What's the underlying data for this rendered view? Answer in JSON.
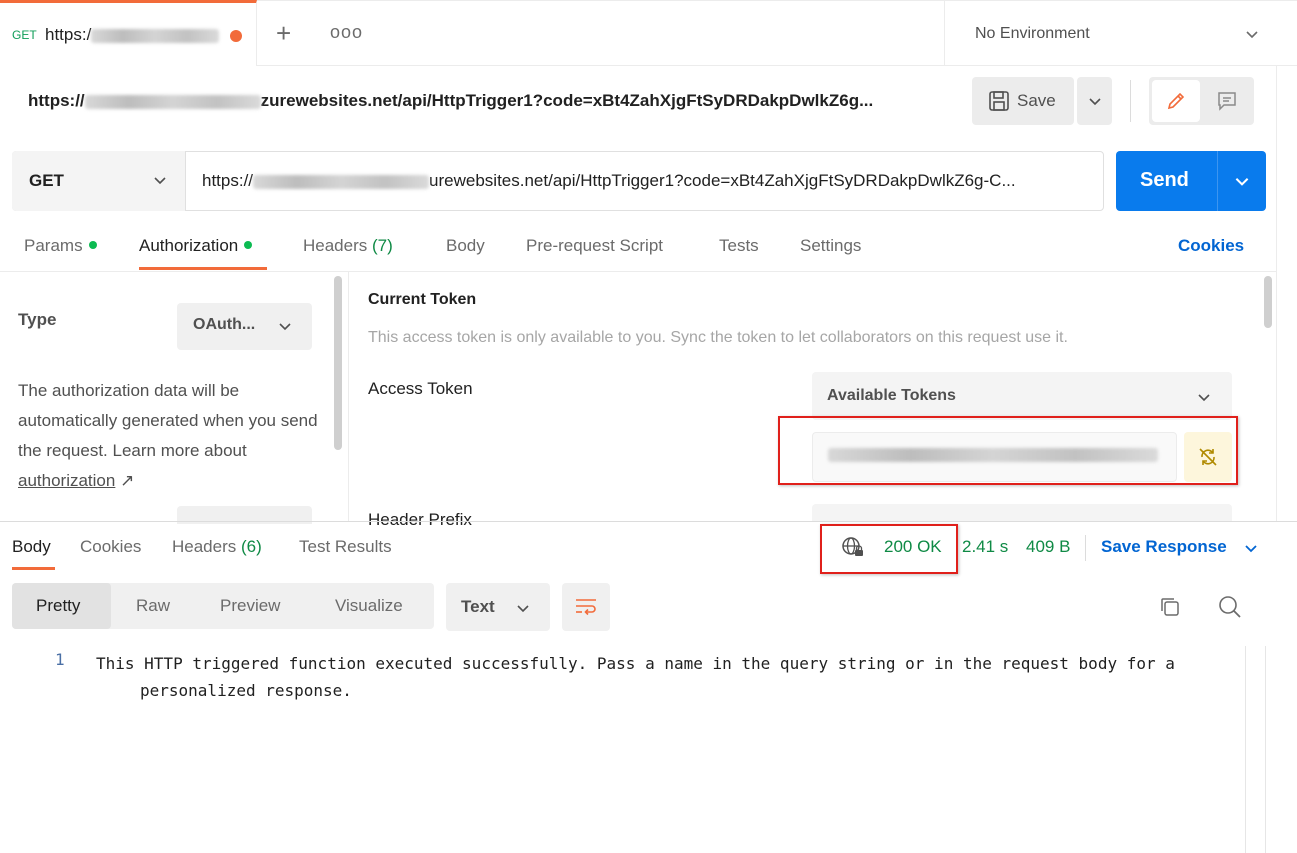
{
  "tab": {
    "method": "GET",
    "url_prefix": "https:/"
  },
  "tabbar": {
    "new_tab": "+",
    "more": "ooo"
  },
  "environment": {
    "label": "No Environment"
  },
  "request": {
    "name_prefix": "https://",
    "name_suffix": "zurewebsites.net/api/HttpTrigger1?code=xBt4ZahXjgFtSyDRDakpDwlkZ6g...",
    "save_label": "Save"
  },
  "urlbar": {
    "method": "GET",
    "url_prefix": "https://",
    "url_suffix": "urewebsites.net/api/HttpTrigger1?code=xBt4ZahXjgFtSyDRDakpDwlkZ6g-C...",
    "send_label": "Send"
  },
  "request_tabs": {
    "params": "Params",
    "authorization": "Authorization",
    "headers": "Headers",
    "headers_count": "(7)",
    "body": "Body",
    "prerequest": "Pre-request Script",
    "tests": "Tests",
    "settings": "Settings",
    "cookies": "Cookies"
  },
  "auth": {
    "type_label": "Type",
    "type_value": "OAuth...",
    "description": "The authorization data will be automatically generated when you send the request. Learn more about ",
    "link_text": "authorization",
    "link_arrow": "↗",
    "current_token_title": "Current Token",
    "current_token_desc": "This access token is only available to you. Sync the token to let collaborators on this request use it.",
    "access_token_label": "Access Token",
    "available_tokens": "Available Tokens",
    "header_prefix_label": "Header Prefix"
  },
  "response_tabs": {
    "body": "Body",
    "cookies": "Cookies",
    "headers": "Headers",
    "headers_count": "(6)",
    "test_results": "Test Results"
  },
  "response_meta": {
    "status": "200 OK",
    "time": "2.41 s",
    "size": "409 B",
    "save_response": "Save Response"
  },
  "view": {
    "pretty": "Pretty",
    "raw": "Raw",
    "preview": "Preview",
    "visualize": "Visualize",
    "format": "Text"
  },
  "response_body": {
    "line_number": "1",
    "text": "This HTTP triggered function executed successfully. Pass a name in the query string or in the request body for a personalized response."
  },
  "colors": {
    "accent_orange": "#f26b3a",
    "send_blue": "#097bed",
    "link_blue": "#0265d2",
    "success_green": "#0f8a45",
    "highlight_red": "#e0201b"
  }
}
